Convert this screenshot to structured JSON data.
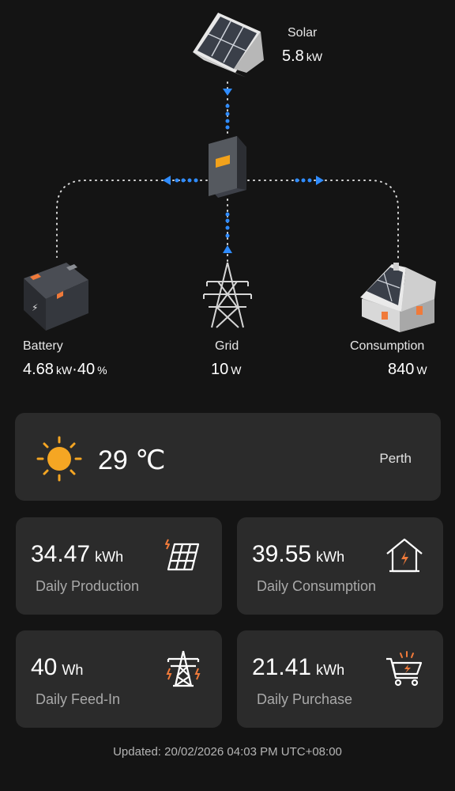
{
  "flow": {
    "solar": {
      "label": "Solar",
      "value": "5.8",
      "unit": "kW"
    },
    "battery": {
      "label": "Battery",
      "power_value": "4.68",
      "power_unit": "kW",
      "separator": "·",
      "soc_value": "40",
      "soc_unit": "%"
    },
    "grid": {
      "label": "Grid",
      "value": "10",
      "unit": "W"
    },
    "consumption": {
      "label": "Consumption",
      "value": "840",
      "unit": "W"
    }
  },
  "weather": {
    "icon": "sun-icon",
    "temperature": "29 ℃",
    "city": "Perth"
  },
  "stats": [
    {
      "value": "34.47",
      "unit": "kWh",
      "label": "Daily Production",
      "icon": "solar-panel-icon"
    },
    {
      "value": "39.55",
      "unit": "kWh",
      "label": "Daily Consumption",
      "icon": "house-energy-icon"
    },
    {
      "value": "40",
      "unit": "Wh",
      "label": "Daily Feed-In",
      "icon": "power-tower-icon"
    },
    {
      "value": "21.41",
      "unit": "kWh",
      "label": "Daily Purchase",
      "icon": "energy-cart-icon"
    }
  ],
  "updated": "Updated: 20/02/2026 04:03 PM UTC+08:00",
  "colors": {
    "background": "#141414",
    "card": "#2b2b2b",
    "flow_accent": "#2f8cff",
    "icon_accent": "#f07a3a",
    "inverter_accent": "#f2a21b"
  }
}
